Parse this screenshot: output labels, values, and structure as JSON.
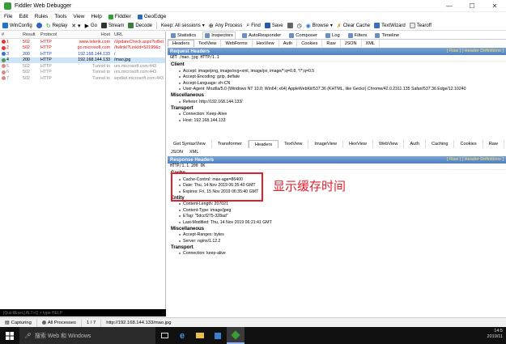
{
  "window": {
    "title": "Fiddler Web Debugger",
    "controls": [
      "—",
      "☐",
      "✕"
    ]
  },
  "menu": [
    "File",
    "Edit",
    "Rules",
    "Tools",
    "View",
    "Help"
  ],
  "menu_extra": [
    {
      "label": "Fiddler",
      "icon": "fiddler-icon",
      "color": "#3a9d3a"
    },
    {
      "label": "GeoEdge",
      "icon": "geoedge-icon",
      "color": "#2a6fb5"
    }
  ],
  "toolbar": {
    "winconfig": "WinConfig",
    "replay": "Replay",
    "go": "Go",
    "stream": "Stream",
    "decode": "Decode",
    "keep": "Keep: All sessions",
    "any_process": "Any Process",
    "find": "Find",
    "save": "Save",
    "browse": "Browse",
    "clear_cache": "Clear Cache",
    "textwizard": "TextWizard",
    "tearoff": "Tearoff"
  },
  "sessions": {
    "headers": [
      "#",
      "Result",
      "Protocol",
      "Host",
      "URL"
    ],
    "rows": [
      {
        "num": "1",
        "result": "502",
        "protocol": "HTTP",
        "host": "www.telerik.com",
        "url": "/UpdateCheck.aspx?isBet",
        "color": "#d11",
        "icon": "error-icon"
      },
      {
        "num": "2",
        "result": "502",
        "protocol": "HTTP",
        "host": "go.microsoft.com",
        "url": "/fwlink/?LinkId=52199&c",
        "color": "#d11",
        "icon": "error-icon"
      },
      {
        "num": "3",
        "result": "200",
        "protocol": "HTTP",
        "host": "192.168.144.133",
        "url": "/",
        "color": "#1a3fb0",
        "icon": "page-icon"
      },
      {
        "num": "4",
        "result": "200",
        "protocol": "HTTP",
        "host": "192.168.144.133",
        "url": "/mao.jpg",
        "color": "#000",
        "icon": "image-icon",
        "selected": true
      },
      {
        "num": "5",
        "result": "502",
        "protocol": "HTTP",
        "host": "Tunnel to",
        "url": "urs.microsoft.com:443",
        "color": "#888",
        "icon": "error-icon"
      },
      {
        "num": "6",
        "result": "502",
        "protocol": "HTTP",
        "host": "Tunnel to",
        "url": "urs.microsoft.com:443",
        "color": "#888",
        "icon": "error-icon"
      },
      {
        "num": "7",
        "result": "502",
        "protocol": "HTTP",
        "host": "Tunnel to",
        "url": "wpdiwt.microsoft.com:443",
        "color": "#888",
        "icon": "error-icon"
      }
    ],
    "quickexec": "[QuickExec] ALT+Q > type HELP"
  },
  "tabs_top": [
    {
      "label": "Statistics",
      "icon": "statistics-icon"
    },
    {
      "label": "Inspectors",
      "icon": "inspectors-icon",
      "active": true
    },
    {
      "label": "AutoResponder",
      "icon": "autoresponder-icon"
    },
    {
      "label": "Composer",
      "icon": "composer-icon"
    },
    {
      "label": "Log",
      "icon": "log-icon"
    },
    {
      "label": "Filters",
      "icon": "filters-icon"
    },
    {
      "label": "Timeline",
      "icon": "timeline-icon"
    }
  ],
  "request_tabs": [
    "Headers",
    "TextView",
    "WebForms",
    "HexView",
    "Auth",
    "Cookies",
    "Raw",
    "JSON",
    "XML"
  ],
  "request": {
    "header": "Request Headers",
    "links": "[ Raw ]   [ Header Definitions ]",
    "line": "GET /mao.jpg HTTP/1.1",
    "groups": [
      {
        "name": "Client",
        "items": [
          "Accept: image/png, image/svg+xml, image/jxr, image/*;q=0.8, */*;q=0.5",
          "Accept-Encoding: gzip, deflate",
          "Accept-Language: zh-CN",
          "User-Agent: Mozilla/5.0 (Windows NT 10.0; Win64; x64) AppleWebKit/537.36 (KHTML, like Gecko) Chrome/42.0.2311.135 Safari/537.36 Edge/12.10240"
        ]
      },
      {
        "name": "Miscellaneous",
        "items": [
          "Referer: http://192.168.144.133/"
        ]
      },
      {
        "name": "Transport",
        "items": [
          "Connection: Keep-Alive",
          "Host: 192.168.144.133"
        ]
      }
    ]
  },
  "response_tabs_1": [
    "Get SyntaxView",
    "Transformer",
    "Headers",
    "TextView",
    "ImageView",
    "HexView",
    "WebView",
    "Auth",
    "Caching",
    "Cookies",
    "Raw"
  ],
  "response_tabs_2": [
    "JSON",
    "XML"
  ],
  "response": {
    "header": "Response Headers",
    "links": "[ Raw ]   [ Header Definitions ]",
    "line": "HTTP/1.1 200 OK",
    "groups": [
      {
        "name": "Cache",
        "items": [
          "Cache-Control: max-age=86400",
          "Date: Thu, 14 Nov 2019 06:35:40 GMT",
          "Expires: Fri, 15 Nov 2019 06:35:40 GMT"
        ]
      },
      {
        "name": "Entity",
        "items": [
          "Content-Length: 207021",
          "Content-Type: image/jpeg",
          "ETag: \"5dccf275-328ad\"",
          "Last-Modified: Thu, 14 Nov 2019 06:21:41 GMT"
        ]
      },
      {
        "name": "Miscellaneous",
        "items": [
          "Accept-Ranges: bytes",
          "Server: nginx/1.12.2"
        ]
      },
      {
        "name": "Transport",
        "items": [
          "Connection: keep-alive"
        ]
      }
    ]
  },
  "annotation": "显示缓存时间",
  "status": {
    "capturing": "Capturing",
    "processes": "All Processes",
    "count": "1 / 7",
    "url": "http://192.168.144.133/mao.jpg"
  },
  "taskbar": {
    "search": "搜索 Web 和 Windows",
    "time": "14:5",
    "date": "2019/11"
  },
  "colors": {
    "accent": "#4f7fbf",
    "annotation": "#e2202c",
    "link": "#ffe06a"
  }
}
